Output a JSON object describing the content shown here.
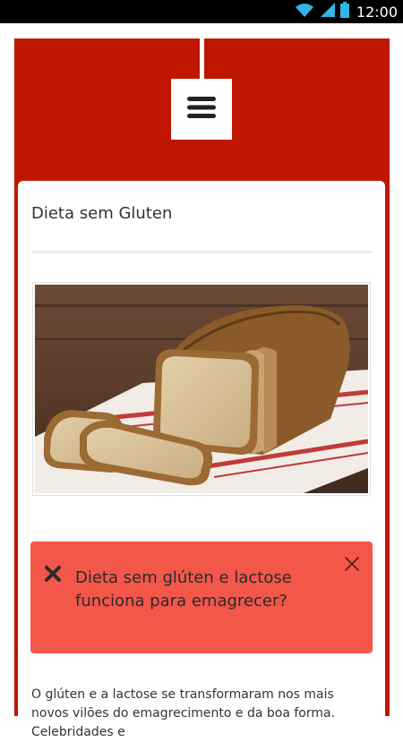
{
  "status_bar": {
    "time": "12:00",
    "icons": [
      "wifi-icon",
      "signal-icon",
      "battery-icon"
    ]
  },
  "header": {
    "menu_icon": "hamburger-menu-icon"
  },
  "card": {
    "title": "Dieta sem Gluten",
    "image_icon": "bread-loaf-photo",
    "alert": {
      "text": "Dieta sem glúten e lactose funciona para emagrecer?",
      "leading_icon": "x-mark-icon",
      "close_icon": "close-icon"
    },
    "body": "O glúten e a lactose se transformaram nos mais novos vilões do emagrecimento e da boa forma. Celebridades e"
  },
  "colors": {
    "frame_red": "#bf1600",
    "alert_bg": "#f2574a",
    "status_accent": "#33b5e5"
  }
}
